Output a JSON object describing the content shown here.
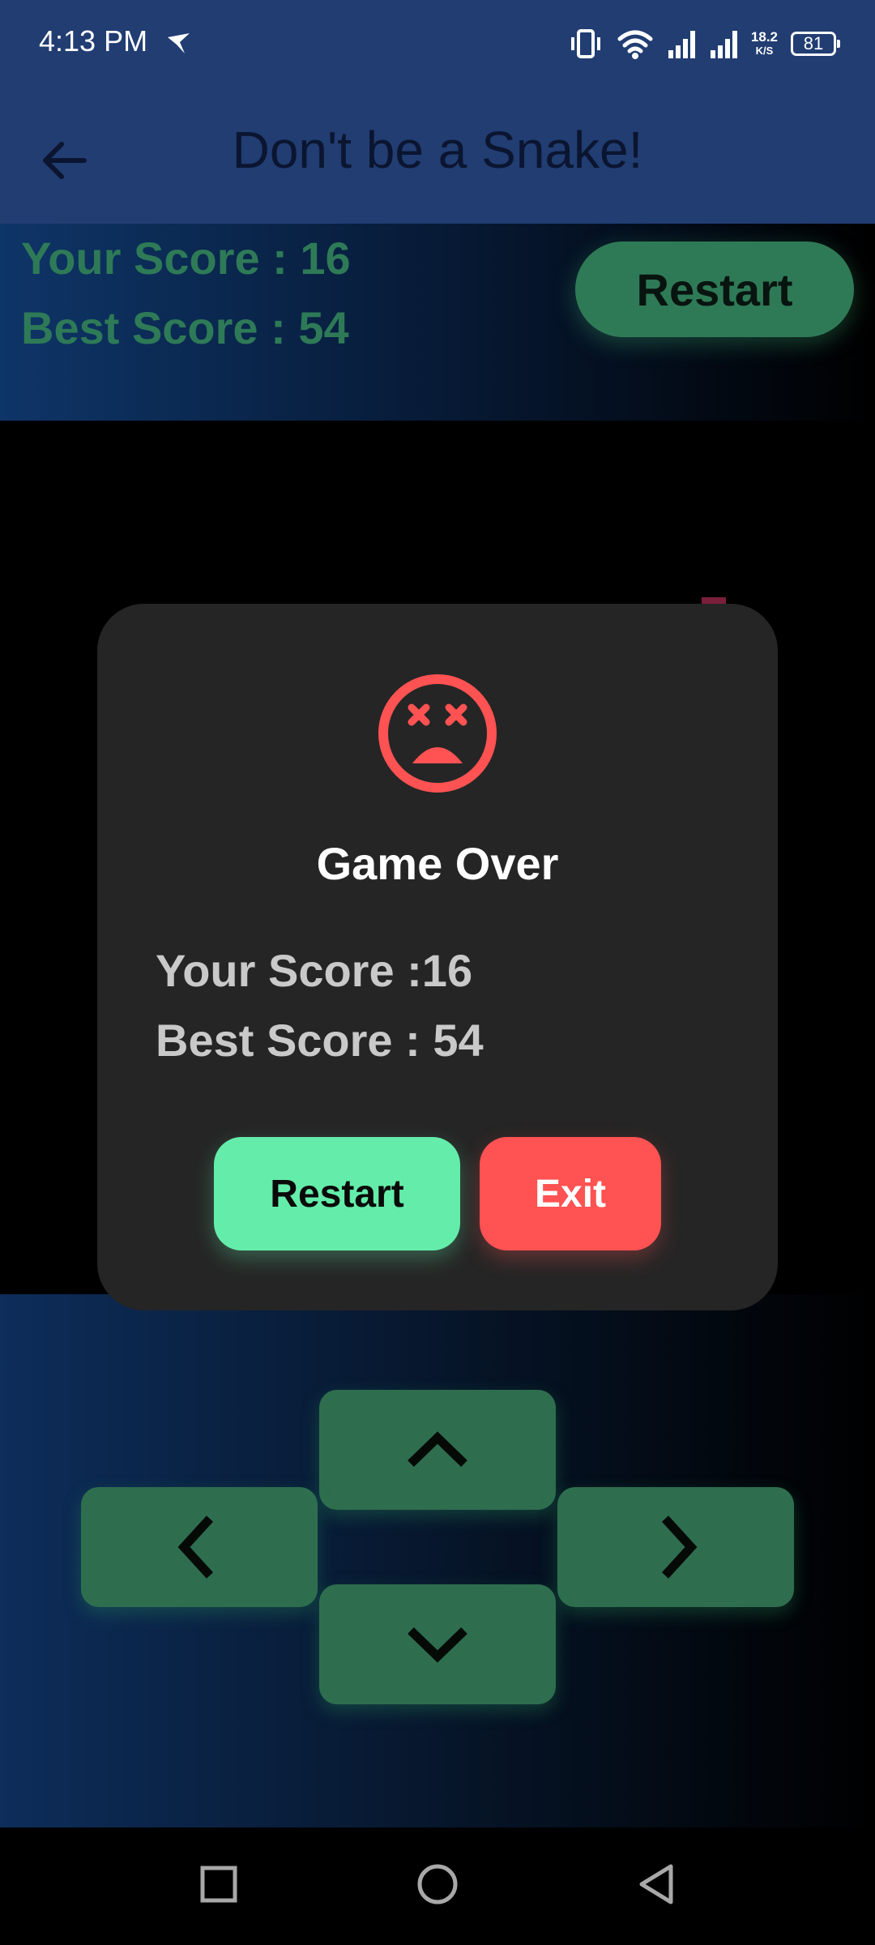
{
  "status_bar": {
    "time": "4:13 PM",
    "network_speed_value": "18.2",
    "network_speed_unit": "K/S",
    "battery": "81",
    "icons": [
      "navigation-arrow-icon",
      "vibrate-icon",
      "wifi-icon",
      "signal-icon",
      "signal-icon"
    ]
  },
  "app_bar": {
    "title": "Don't be a Snake!",
    "back_icon": "arrow-left-icon"
  },
  "score_panel": {
    "your_score": "Your Score : 16",
    "best_score": "Best Score : 54",
    "restart_label": "Restart"
  },
  "dialog": {
    "icon": "dead-face-icon",
    "title": "Game Over",
    "your_score": "Your Score :16",
    "best_score": "Best Score : 54",
    "restart_label": "Restart",
    "exit_label": "Exit"
  },
  "controls": {
    "icons": [
      "chevron-up-icon",
      "chevron-left-icon",
      "chevron-right-icon",
      "chevron-down-icon"
    ]
  },
  "nav_bar": {
    "icons": [
      "recent-apps-icon",
      "home-icon",
      "back-triangle-icon"
    ]
  },
  "colors": {
    "app_bar": "#213d72",
    "score_text": "#2e7a57",
    "control_button": "#2e6e4e",
    "dialog_bg": "#252525",
    "restart_accent": "#64edaa",
    "exit_accent": "#ff5252"
  }
}
